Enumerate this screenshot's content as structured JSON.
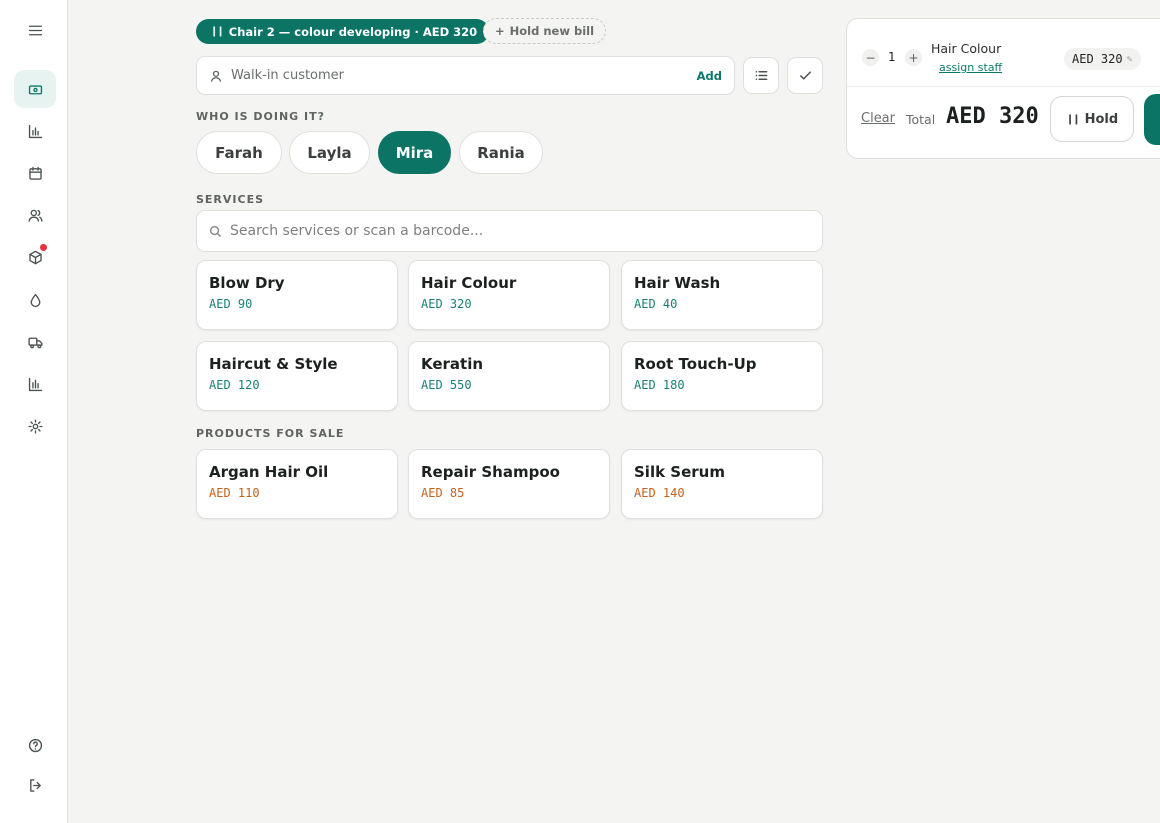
{
  "sidebar": {
    "items": [
      {
        "icon": "menu-icon"
      },
      {
        "icon": "cash-register-icon",
        "active": true
      },
      {
        "icon": "bar-chart-icon"
      },
      {
        "icon": "calendar-icon"
      },
      {
        "icon": "users-icon"
      },
      {
        "icon": "package-icon",
        "badge": true
      },
      {
        "icon": "droplet-icon"
      },
      {
        "icon": "truck-icon"
      },
      {
        "icon": "reports-icon"
      },
      {
        "icon": "settings-icon"
      },
      {
        "icon": "help-icon"
      },
      {
        "icon": "logout-icon"
      }
    ]
  },
  "bills": {
    "active_label": "Chair 2 — colour developing · AED 320",
    "new_label": "Hold new bill"
  },
  "customer": {
    "placeholder": "Walk-in customer",
    "add_label": "Add"
  },
  "staff": {
    "heading": "WHO IS DOING IT?",
    "members": [
      "Farah",
      "Layla",
      "Mira",
      "Rania"
    ],
    "selected": "Mira"
  },
  "services": {
    "heading": "SERVICES",
    "search_placeholder": "Search services or scan a barcode...",
    "items": [
      {
        "name": "Blow Dry",
        "price": "AED 90"
      },
      {
        "name": "Hair Colour",
        "price": "AED 320"
      },
      {
        "name": "Hair Wash",
        "price": "AED 40"
      },
      {
        "name": "Haircut & Style",
        "price": "AED 120"
      },
      {
        "name": "Keratin",
        "price": "AED 550"
      },
      {
        "name": "Root Touch-Up",
        "price": "AED 180"
      }
    ]
  },
  "products": {
    "heading": "PRODUCTS FOR SALE",
    "items": [
      {
        "name": "Argan Hair Oil",
        "price": "AED 110"
      },
      {
        "name": "Repair Shampoo",
        "price": "AED 85"
      },
      {
        "name": "Silk Serum",
        "price": "AED 140"
      }
    ]
  },
  "cart": {
    "line": {
      "qty": "1",
      "name": "Hair Colour",
      "assign": "assign staff",
      "price": "AED 320"
    },
    "clear_label": "Clear",
    "total_label": "Total",
    "total_value": "AED 320",
    "hold_label": "Hold"
  },
  "colors": {
    "accent": "#0c7465",
    "service_price": "#1a7f75",
    "product_price": "#c4621c"
  }
}
